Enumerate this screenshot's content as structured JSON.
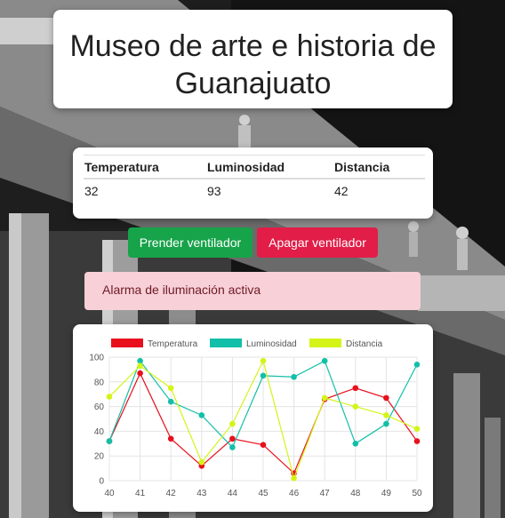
{
  "page": {
    "title": "Museo de arte e historia de Guanajuato"
  },
  "sensors": {
    "headers": [
      "Temperatura",
      "Luminosidad",
      "Distancia"
    ],
    "values": [
      "32",
      "93",
      "42"
    ]
  },
  "controls": {
    "fan_on_label": "Prender ventilador",
    "fan_off_label": "Apagar ventilador"
  },
  "alert": {
    "message": "Alarma de iluminación activa"
  },
  "colors": {
    "fan_on": "#17a34a",
    "fan_off": "#e11d48",
    "alert_bg": "#f8d0d8"
  },
  "chart_data": {
    "type": "line",
    "x": [
      40,
      41,
      42,
      43,
      44,
      45,
      46,
      47,
      48,
      49,
      50
    ],
    "ylim": [
      0,
      100
    ],
    "yticks": [
      0,
      20,
      40,
      60,
      80,
      100
    ],
    "grid": true,
    "legend": "top",
    "series": [
      {
        "name": "Temperatura",
        "color": "#e8101c",
        "values": [
          32,
          87,
          34,
          12,
          34,
          29,
          6,
          66,
          75,
          67,
          32
        ]
      },
      {
        "name": "Luminosidad",
        "color": "#12bfa8",
        "values": [
          32,
          97,
          64,
          53,
          27,
          85,
          84,
          97,
          30,
          46,
          94
        ]
      },
      {
        "name": "Distancia",
        "color": "#d4f418",
        "values": [
          68,
          93,
          75,
          15,
          46,
          97,
          2,
          67,
          60,
          53,
          42
        ]
      }
    ]
  }
}
